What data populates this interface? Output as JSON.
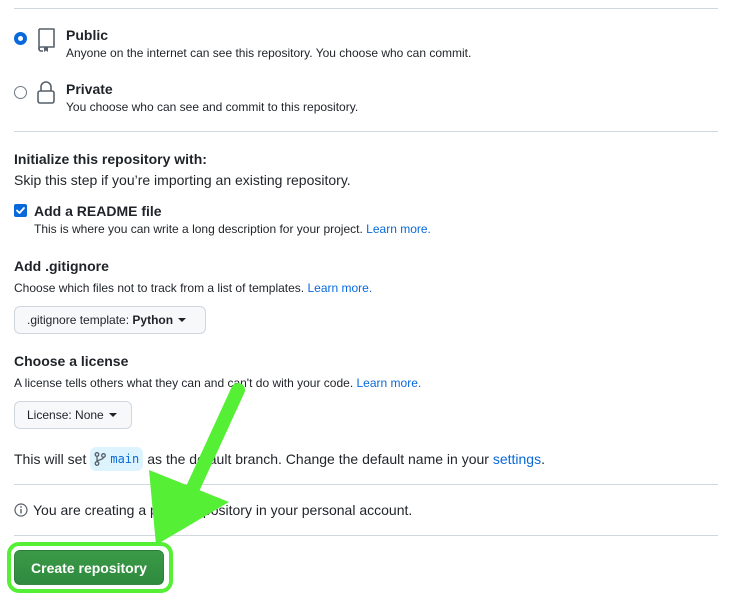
{
  "visibility": {
    "public": {
      "title": "Public",
      "description": "Anyone on the internet can see this repository. You choose who can commit.",
      "selected": true
    },
    "private": {
      "title": "Private",
      "description": "You choose who can see and commit to this repository.",
      "selected": false
    }
  },
  "initialize": {
    "title": "Initialize this repository with:",
    "description": "Skip this step if you’re importing an existing repository."
  },
  "readme": {
    "label": "Add a README file",
    "checked": true,
    "description": "This is where you can write a long description for your project.",
    "learn_more": "Learn more."
  },
  "gitignore": {
    "title": "Add .gitignore",
    "description": "Choose which files not to track from a list of templates.",
    "learn_more": "Learn more.",
    "button_prefix": ".gitignore template:",
    "button_value": "Python"
  },
  "license": {
    "title": "Choose a license",
    "description": "A license tells others what they can and can't do with your code.",
    "learn_more": "Learn more.",
    "button_prefix": "License:",
    "button_value": "None"
  },
  "branch": {
    "prefix": "This will set",
    "name": "main",
    "middle": "as the default branch. Change the default name in your",
    "settings_link": "settings",
    "suffix": "."
  },
  "info": {
    "text": "You are creating a public repository in your personal account."
  },
  "create_button": {
    "label": "Create repository"
  },
  "annotation": {
    "color": "#55f036"
  }
}
